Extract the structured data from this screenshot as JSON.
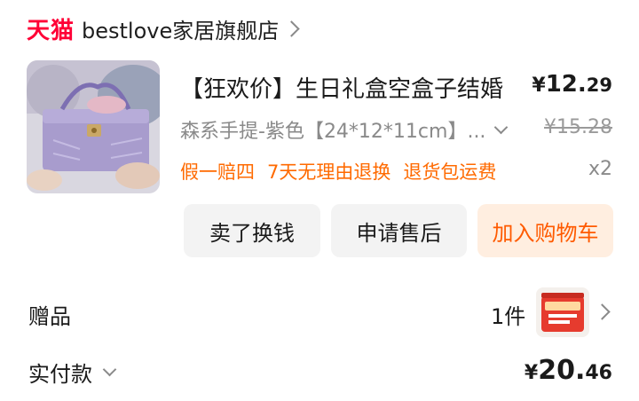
{
  "store": {
    "brand": "天猫",
    "name": "bestlove家居旗舰店"
  },
  "product": {
    "title": "【狂欢价】生日礼盒空盒子结婚",
    "spec": "森系手提-紫色【24*12*11cm】...",
    "price_currency": "¥",
    "price_int": "12.",
    "price_dec": "29",
    "original_price": "¥15.28",
    "guarantees": [
      "假一赔四",
      "7天无理由退换",
      "退货包运费"
    ],
    "quantity": "x2",
    "image_icon": "purple-gift-box-image"
  },
  "actions": {
    "sell": "卖了换钱",
    "after_sale": "申请售后",
    "add_cart": "加入购物车"
  },
  "gift": {
    "label": "赠品",
    "count": "1件",
    "image_icon": "gift-package-image"
  },
  "payment": {
    "label": "实付款",
    "currency": "¥",
    "amount_int": "20.",
    "amount_dec": "46"
  },
  "colors": {
    "tmall_red": "#ff0036",
    "accent_orange": "#ff6a00",
    "cart_bg": "#ffeee0"
  }
}
